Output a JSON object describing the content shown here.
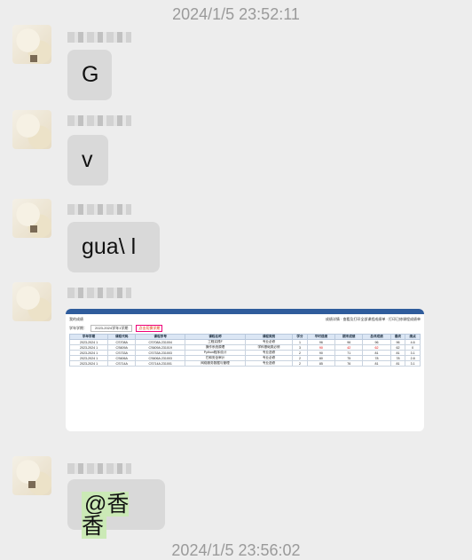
{
  "timestamps": {
    "top": "2024/1/5 23:52:11",
    "bottom": "2024/1/5 23:56:02"
  },
  "messages": [
    {
      "text": "G"
    },
    {
      "text": "v"
    },
    {
      "text": "gua\\ l"
    },
    {
      "image": true
    },
    {
      "mention": "@香香"
    }
  ],
  "screenshot": {
    "title": "我的成绩",
    "actions": [
      "成绩详情",
      "查看及打印全部课程成绩单",
      "打印已修课程成绩单"
    ],
    "filter_label": "学年学期：",
    "filter_value": "2023-2024学年1学期",
    "filter_button": "点击切换学期",
    "columns": [
      "学年学期",
      "课程代码",
      "课程序号",
      "课程名称",
      "课程类别",
      "学分",
      "平时成绩",
      "期末成绩",
      "总评成绩",
      "最终",
      "绩点"
    ],
    "rows": [
      [
        "2023-2024 1",
        "CS708A",
        "CS708A.231004",
        "工程实践F",
        "专业必修",
        "1",
        "96",
        "96",
        "96",
        "96",
        "4.6"
      ],
      [
        "2023-2024 1",
        "CS609A",
        "CS609A.231019",
        "操作系统原理",
        "学科基础类必修",
        "3",
        "90",
        "42",
        "62",
        "62",
        "0"
      ],
      [
        "2023-2024 1",
        "CS733A",
        "CS733A.231003",
        "Python程序设计",
        "专业选修",
        "2",
        "90",
        "71",
        "81",
        "81",
        "3.1"
      ],
      [
        "2023-2024 1",
        "CS606A",
        "CS606A.231003",
        "它和安全审计",
        "专业必修",
        "2",
        "80",
        "75",
        "78",
        "78",
        "2.8"
      ],
      [
        "2023-2024 1",
        "CS714A",
        "CS714A.231001",
        "网络服务数据与管理",
        "专业选修",
        "2",
        "85",
        "76",
        "81",
        "81",
        "3.1"
      ]
    ]
  }
}
